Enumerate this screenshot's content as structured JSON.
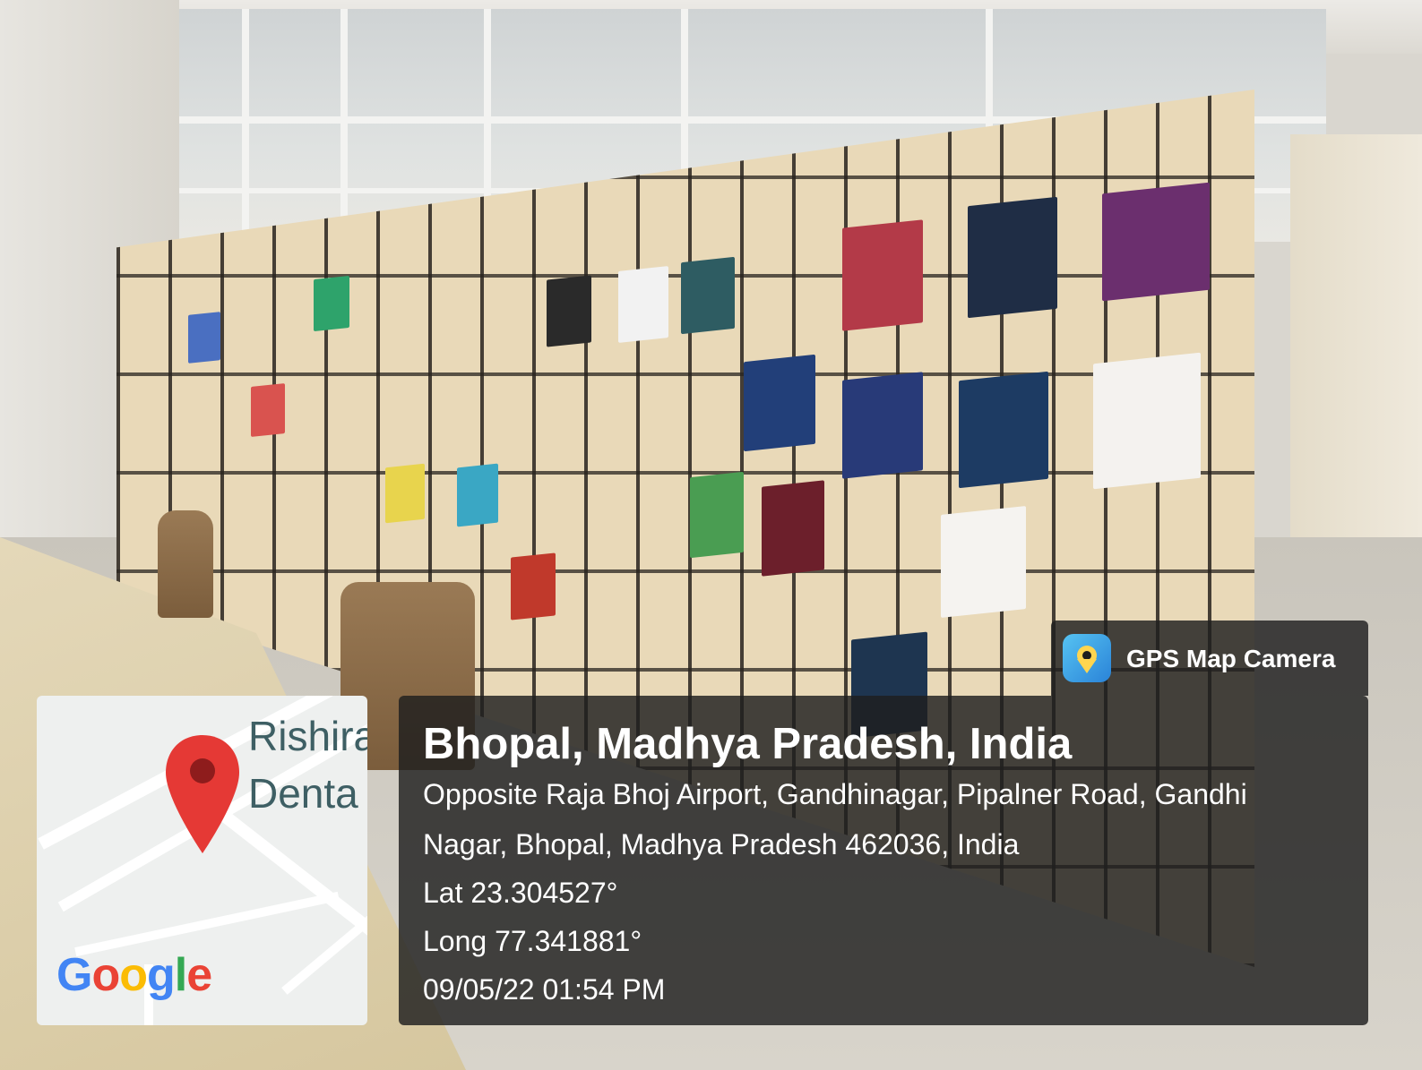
{
  "badge": {
    "label": "GPS Map Camera",
    "icon": "gps-map-camera-icon"
  },
  "map": {
    "label_line1": "Rishira",
    "label_line2": "Denta",
    "logo": "Google",
    "pin_color": "#e53935"
  },
  "location": {
    "title": "Bhopal, Madhya Pradesh, India",
    "address_line1": "Opposite Raja Bhoj Airport, Gandhinagar, Pipalner Road, Gandhi",
    "address_line2": "Nagar, Bhopal, Madhya Pradesh 462036, India",
    "lat": "Lat 23.304527°",
    "long": "Long 77.341881°",
    "datetime": "09/05/22 01:54 PM"
  },
  "colors": {
    "overlay": "#1e1e1e",
    "text": "#ffffff"
  }
}
